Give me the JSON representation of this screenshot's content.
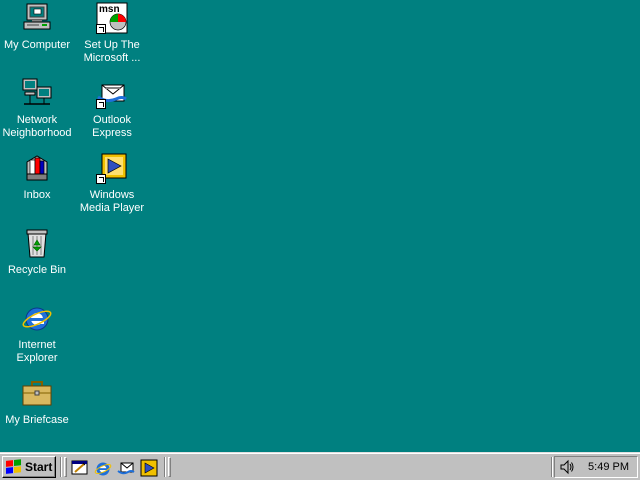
{
  "desktop": {
    "background": "#008080",
    "icons": [
      {
        "label": "My Computer",
        "icon": "my-computer-icon"
      },
      {
        "label": "Set Up The\nMicrosoft ...",
        "icon": "msn-icon"
      },
      {
        "label": "Network\nNeighborhood",
        "icon": "network-neighborhood-icon"
      },
      {
        "label": "Outlook\nExpress",
        "icon": "outlook-express-icon"
      },
      {
        "label": "Inbox",
        "icon": "inbox-icon"
      },
      {
        "label": "Windows\nMedia Player",
        "icon": "media-player-icon"
      },
      {
        "label": "Recycle Bin",
        "icon": "recycle-bin-icon"
      },
      {
        "label": "Internet\nExplorer",
        "icon": "internet-explorer-icon"
      },
      {
        "label": "My Briefcase",
        "icon": "briefcase-icon"
      }
    ],
    "msn_logo_text": "msn"
  },
  "taskbar": {
    "start_label": "Start",
    "quick_launch": [
      {
        "icon": "show-desktop-icon"
      },
      {
        "icon": "internet-explorer-icon"
      },
      {
        "icon": "outlook-express-icon"
      },
      {
        "icon": "media-player-icon"
      }
    ],
    "clock": "5:49 PM",
    "tray_icon": "volume-icon"
  }
}
